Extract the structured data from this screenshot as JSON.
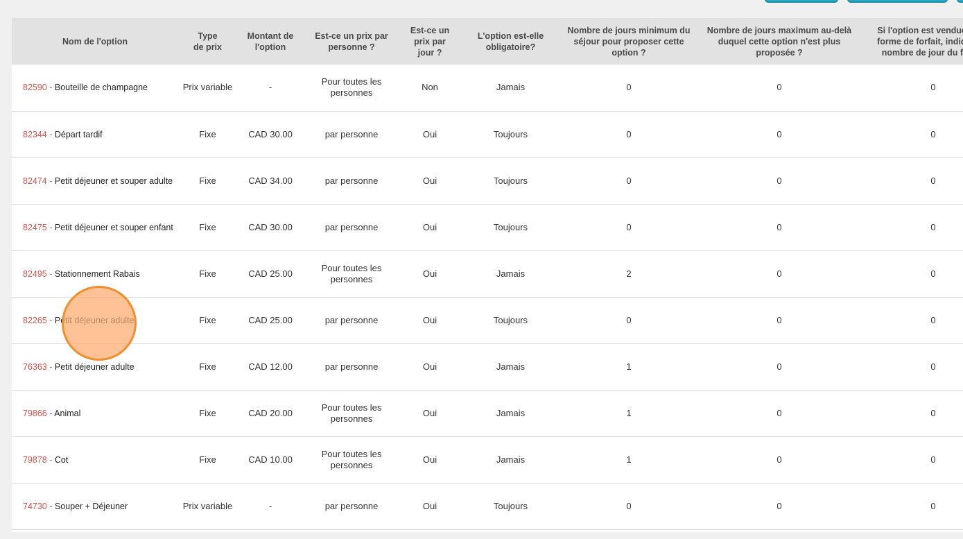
{
  "table": {
    "headers": [
      "Nom de l'option",
      "Type\nde prix",
      "Montant de l'option",
      "Est-ce un prix par personne ?",
      "Est-ce un prix par jour ?",
      "L'option est-elle obligatoire?",
      "Nombre de jours minimum du séjour pour proposer cette option ?",
      "Nombre de jours maximum au-delà duquel cette option n'est plus proposée ?",
      "Si l'option est vendue sous forme de forfait, indiquer le nombre de jour du forfait"
    ],
    "rows": [
      {
        "id": "82590",
        "name": "Bouteille de champagne",
        "type": "Prix variable",
        "amount": "-",
        "per_person": "Pour toutes les personnes",
        "per_day": "Non",
        "mandatory": "Jamais",
        "min_days": "0",
        "max_days": "0",
        "package_days": "0"
      },
      {
        "id": "82344",
        "name": "Départ tardif",
        "type": "Fixe",
        "amount": "CAD 30.00",
        "per_person": "par personne",
        "per_day": "Oui",
        "mandatory": "Toujours",
        "min_days": "0",
        "max_days": "0",
        "package_days": "0"
      },
      {
        "id": "82474",
        "name": "Petit déjeuner et souper adulte",
        "type": "Fixe",
        "amount": "CAD 34.00",
        "per_person": "par personne",
        "per_day": "Oui",
        "mandatory": "Toujours",
        "min_days": "0",
        "max_days": "0",
        "package_days": "0"
      },
      {
        "id": "82475",
        "name": "Petit déjeuner et souper enfant",
        "type": "Fixe",
        "amount": "CAD 30.00",
        "per_person": "par personne",
        "per_day": "Oui",
        "mandatory": "Toujours",
        "min_days": "0",
        "max_days": "0",
        "package_days": "0"
      },
      {
        "id": "82495",
        "name": "Stationnement Rabais",
        "type": "Fixe",
        "amount": "CAD 25.00",
        "per_person": "Pour toutes les personnes",
        "per_day": "Oui",
        "mandatory": "Jamais",
        "min_days": "2",
        "max_days": "0",
        "package_days": "0"
      },
      {
        "id": "82265",
        "name": "Petit déjeuner adulte",
        "type": "Fixe",
        "amount": "CAD 25.00",
        "per_person": "par personne",
        "per_day": "Oui",
        "mandatory": "Toujours",
        "min_days": "0",
        "max_days": "0",
        "package_days": "0"
      },
      {
        "id": "76363",
        "name": "Petit déjeuner adulte",
        "type": "Fixe",
        "amount": "CAD 12.00",
        "per_person": "par personne",
        "per_day": "Oui",
        "mandatory": "Jamais",
        "min_days": "1",
        "max_days": "0",
        "package_days": "0"
      },
      {
        "id": "79866",
        "name": "Animal",
        "type": "Fixe",
        "amount": "CAD 20.00",
        "per_person": "Pour toutes les personnes",
        "per_day": "Oui",
        "mandatory": "Jamais",
        "min_days": "1",
        "max_days": "0",
        "package_days": "0"
      },
      {
        "id": "79878",
        "name": "Cot",
        "type": "Fixe",
        "amount": "CAD 10.00",
        "per_person": "Pour toutes les personnes",
        "per_day": "Oui",
        "mandatory": "Jamais",
        "min_days": "1",
        "max_days": "0",
        "package_days": "0"
      },
      {
        "id": "74730",
        "name": "Souper + Déjeuner",
        "type": "Prix variable",
        "amount": "-",
        "per_person": "par personne",
        "per_day": "Oui",
        "mandatory": "Toujours",
        "min_days": "0",
        "max_days": "0",
        "package_days": "0"
      }
    ],
    "separator": " - "
  },
  "colors": {
    "header_bg": "#e2e2e2",
    "id_link": "#d9534f",
    "top_button": "#2aa9c4",
    "click_indicator": "#f0902c"
  }
}
